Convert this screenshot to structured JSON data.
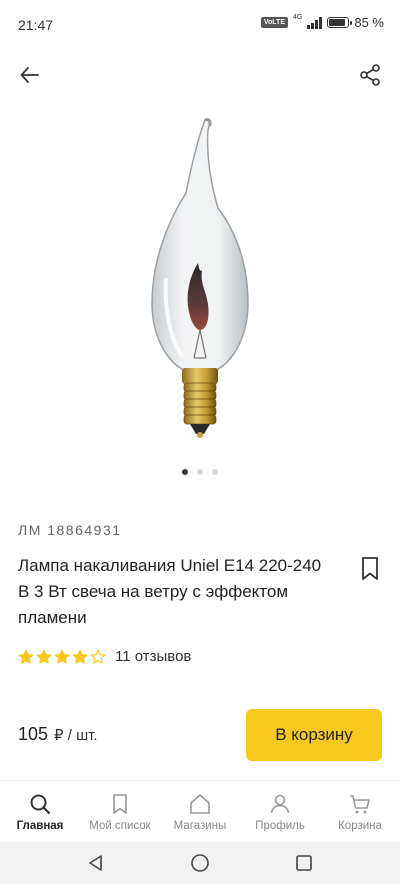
{
  "status_bar": {
    "time": "21:47",
    "volte": "VoLTE",
    "network": "4G",
    "battery_percent": 85,
    "battery_text": "85 %"
  },
  "top_nav": {
    "back_icon": "arrow-left-icon",
    "share_icon": "share-icon"
  },
  "gallery": {
    "image_count": 3,
    "active_index": 0,
    "image_subject": "candle-flame-bulb"
  },
  "product": {
    "sku": "ЛМ 18864931",
    "title": "Лампа накаливания Uniel E14 220-240 В 3 Вт свеча на ветру с эффектом пламени",
    "rating": 4,
    "rating_max": 5,
    "reviews": "11 отзывов",
    "price_value": "105",
    "price_unit": "₽ / шт."
  },
  "actions": {
    "add_to_cart": "В корзину",
    "accent_color": "#f8c81c"
  },
  "bottom_nav": {
    "items": [
      {
        "label": "Главная",
        "icon": "search-icon"
      },
      {
        "label": "Мой список",
        "icon": "bookmark-icon"
      },
      {
        "label": "Магазины",
        "icon": "store-icon"
      },
      {
        "label": "Профиль",
        "icon": "person-icon"
      },
      {
        "label": "Корзина",
        "icon": "cart-icon"
      }
    ],
    "active_index": 0
  },
  "system_nav": {
    "back_icon": "triangle-back-icon",
    "home_icon": "circle-home-icon",
    "recents_icon": "square-recents-icon"
  }
}
